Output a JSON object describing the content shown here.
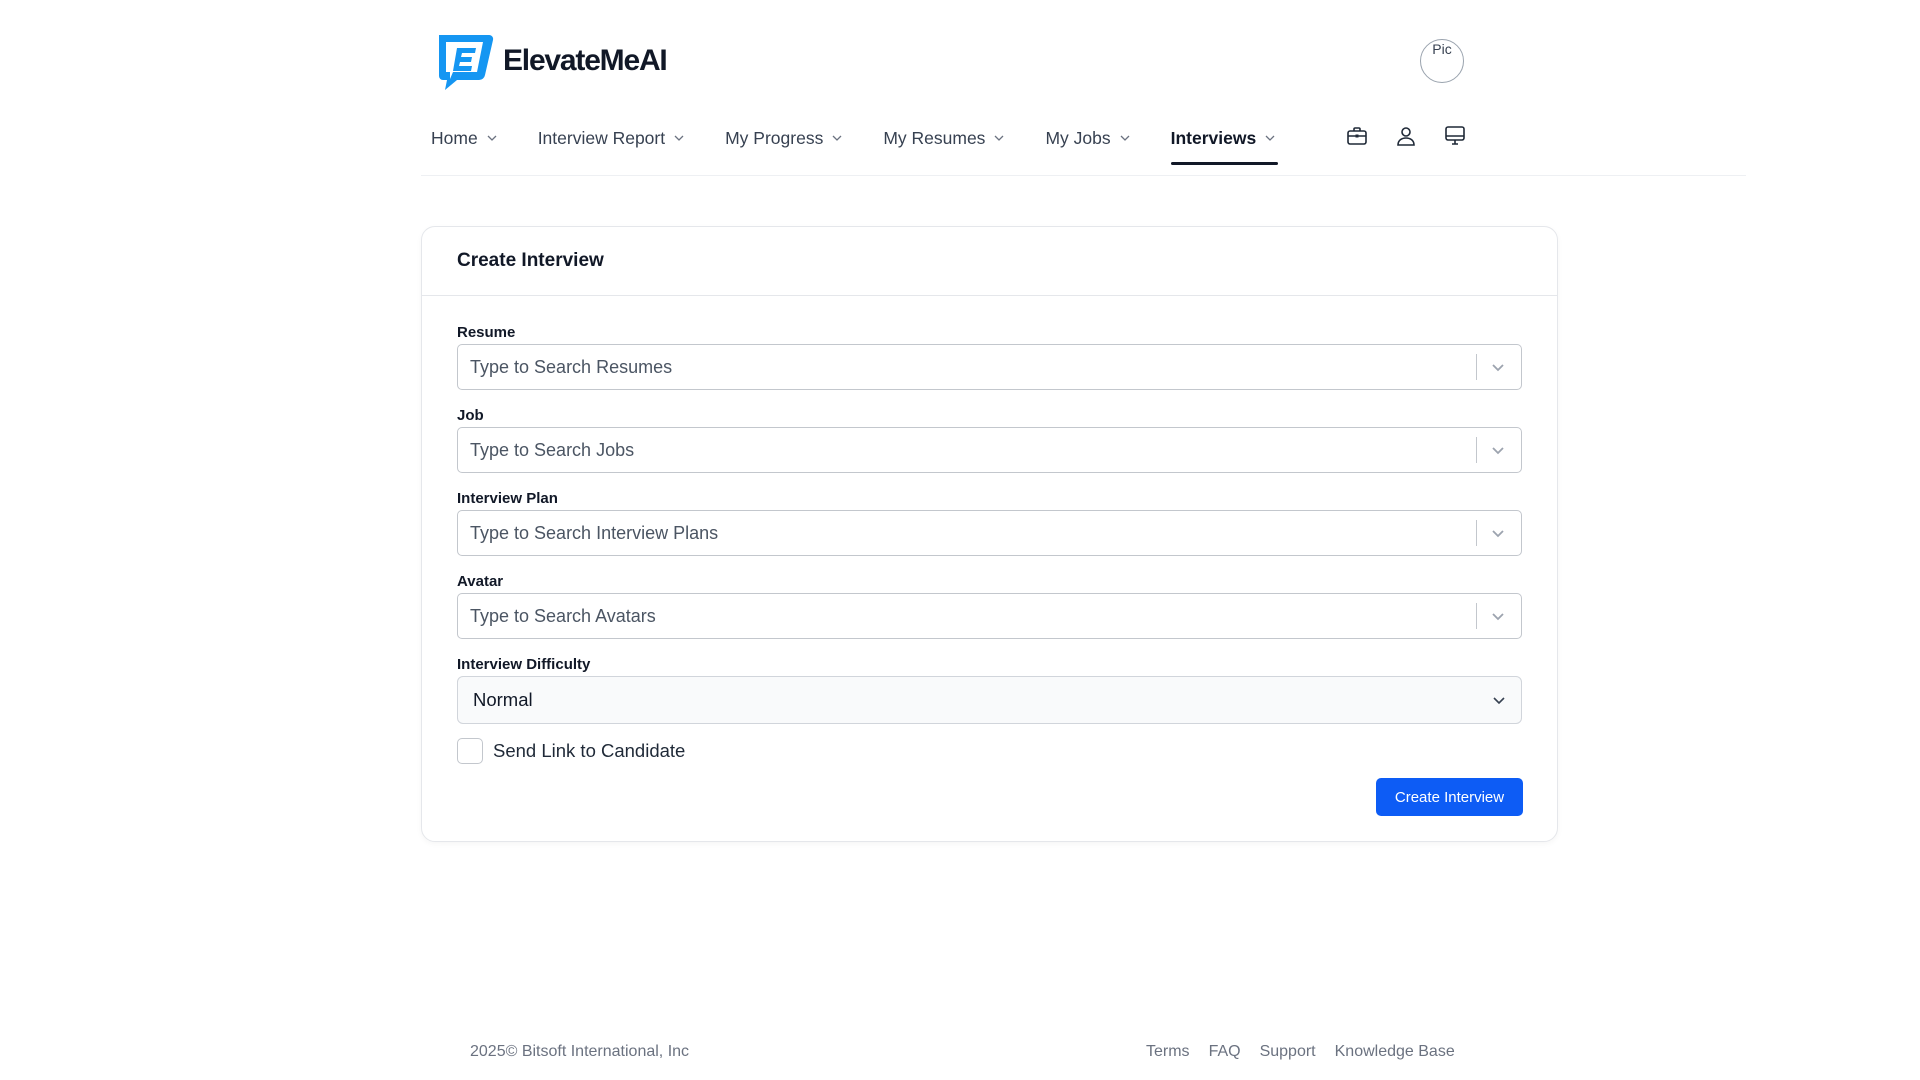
{
  "brand": {
    "name": "ElevateMeAI",
    "logo_colors": {
      "primary": "#1596f2",
      "dark": "#111827"
    }
  },
  "header": {
    "avatar_text": "Pic"
  },
  "nav": {
    "items": [
      {
        "label": "Home",
        "active": false
      },
      {
        "label": "Interview Report",
        "active": false
      },
      {
        "label": "My Progress",
        "active": false
      },
      {
        "label": "My Resumes",
        "active": false
      },
      {
        "label": "My Jobs",
        "active": false
      },
      {
        "label": "Interviews",
        "active": true
      }
    ],
    "icons": [
      "briefcase-icon",
      "user-icon",
      "monitor-icon"
    ]
  },
  "card": {
    "title": "Create Interview",
    "fields": {
      "resume": {
        "label": "Resume",
        "placeholder": "Type to Search Resumes"
      },
      "job": {
        "label": "Job",
        "placeholder": "Type to Search Jobs"
      },
      "plan": {
        "label": "Interview Plan",
        "placeholder": "Type to Search Interview Plans"
      },
      "avatar": {
        "label": "Avatar",
        "placeholder": "Type to Search Avatars"
      },
      "difficulty": {
        "label": "Interview Difficulty",
        "value": "Normal"
      }
    },
    "send_link": {
      "label": "Send Link to Candidate",
      "checked": false
    },
    "submit_label": "Create Interview",
    "accent_color": "#0d5cf5"
  },
  "footer": {
    "copyright": "2025©  Bitsoft International, Inc",
    "links": [
      "Terms",
      "FAQ",
      "Support",
      "Knowledge Base"
    ]
  }
}
